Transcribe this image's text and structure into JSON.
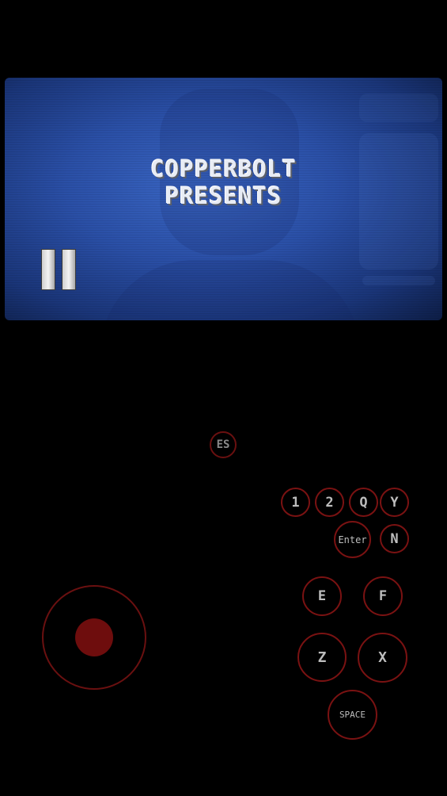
{
  "game": {
    "title_line1": "COPPERBOLT",
    "title_line2": "PRESENTS",
    "pause_icon": "pause-icon"
  },
  "controls": {
    "esc_label": "ES",
    "key_1": "1",
    "key_2": "2",
    "key_q": "Q",
    "key_y": "Y",
    "key_enter": "Enter",
    "key_n": "N",
    "key_e": "E",
    "key_f": "F",
    "key_z": "Z",
    "key_x": "X",
    "key_space": "SPACE"
  },
  "colors": {
    "background": "#000000",
    "screen_blue": "#2a4fa6",
    "button_ring": "#7a1212",
    "joystick_knob": "#6e0d0d",
    "button_text": "#bdbdbd"
  }
}
